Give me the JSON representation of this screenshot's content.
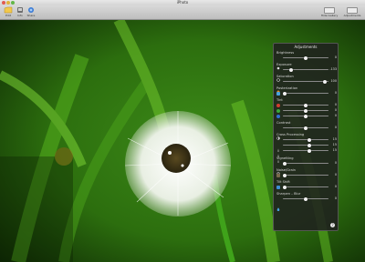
{
  "window": {
    "title": "iPhoto"
  },
  "toolbar": {
    "left_buttons": [
      {
        "label": "Edit",
        "icon": "edit-icon"
      },
      {
        "label": "Info",
        "icon": "info-icon"
      },
      {
        "label": "Share",
        "icon": "share-icon"
      }
    ],
    "right_buttons": [
      {
        "label": "Hide Gallery"
      },
      {
        "label": "Adjustments"
      }
    ]
  },
  "panel": {
    "title": "Adjustments",
    "sections": {
      "brightness": "Brightness",
      "exposure": "Exposure",
      "saturation": "Saturation",
      "posterization": "Posterization",
      "tint": "Tint",
      "contrast": "Contrast",
      "cross_processing": "Cross Processing",
      "vignetting": "Vignetting",
      "noise_grain": "Noise/Grain",
      "tilt_shift": "Tilt Shift",
      "sharpen_blur": "Sharpen – Blur"
    },
    "values": {
      "brightness": "0",
      "exposure": "-133",
      "saturation": "100",
      "posterization": "0",
      "tint_1": "0",
      "tint_2": "0",
      "tint_3": "0",
      "contrast": "0",
      "cross_1": "15",
      "cross_2": "15",
      "cross_3": "15",
      "vignetting": "0",
      "noise_grain": "0",
      "tilt_shift": "0",
      "sharpen_blur": "0"
    },
    "help": "?"
  }
}
